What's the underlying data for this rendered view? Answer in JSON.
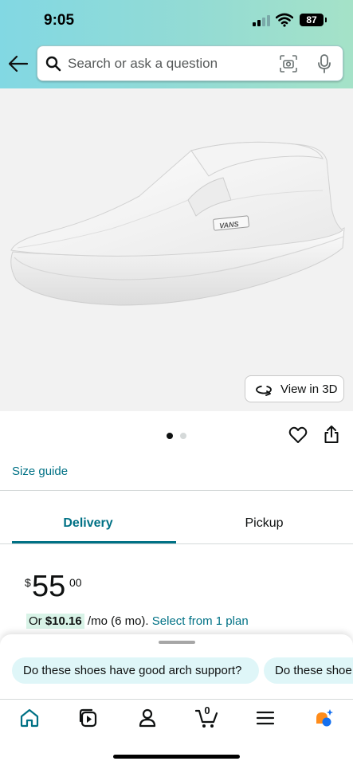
{
  "status_bar": {
    "time": "9:05",
    "battery": "87",
    "icons": [
      "signal-icon",
      "wifi-icon",
      "battery-icon"
    ]
  },
  "search": {
    "placeholder": "Search or ask a question",
    "icons": [
      "back-arrow-icon",
      "search-icon",
      "camera-icon",
      "mic-icon"
    ]
  },
  "product": {
    "brand_on_shoe": "VANS",
    "view_3d_label": "View in 3D",
    "image_index": 1,
    "image_count": 2
  },
  "actions": {
    "icons": [
      "heart-icon",
      "share-icon"
    ]
  },
  "size_guide_label": "Size guide",
  "tabs": [
    {
      "label": "Delivery",
      "selected": true
    },
    {
      "label": "Pickup",
      "selected": false
    }
  ],
  "price": {
    "symbol": "$",
    "whole": "55",
    "fraction": "00"
  },
  "installment": {
    "prefix": "Or",
    "amount": "$10.16",
    "term": "/mo (6 mo).",
    "link": "Select from 1 plan"
  },
  "suggestions": [
    "Do these shoes have good arch support?",
    "Do these shoe"
  ],
  "bottom_nav": {
    "cart_count": "0",
    "items": [
      "home-icon",
      "inspire-icon",
      "account-icon",
      "cart-icon",
      "menu-icon",
      "rufus-icon"
    ]
  },
  "colors": {
    "accent": "#007185",
    "header_start": "#82d8e3",
    "header_end": "#a5e2c8",
    "chip_bg": "#dff6f8",
    "installment_bg": "#d8f3e7",
    "rufus_orange": "#ff8c1a",
    "rufus_blue": "#1570ef"
  }
}
